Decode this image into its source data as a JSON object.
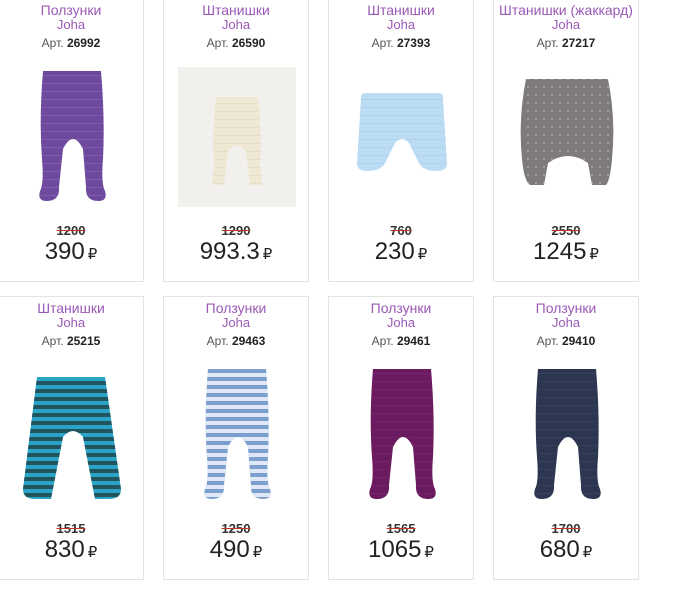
{
  "currency_symbol": "₽",
  "products": [
    {
      "title": "Ползунки",
      "brand": "Joha",
      "sku_label": "Арт.",
      "sku": "26992",
      "old_price": "1200",
      "price": "390",
      "icon": "footed-pants-purple",
      "colors": {
        "main": "#6e4a9e",
        "stripe": "#8865b5"
      }
    },
    {
      "title": "Штанишки",
      "brand": "Joha",
      "sku_label": "Арт.",
      "sku": "26590",
      "old_price": "1290",
      "price": "993.3",
      "icon": "pants-cream",
      "colors": {
        "main": "#efe8d4",
        "stripe": "#e0d6bc"
      }
    },
    {
      "title": "Штанишки",
      "brand": "Joha",
      "sku_label": "Арт.",
      "sku": "27393",
      "old_price": "760",
      "price": "230",
      "icon": "shorts-light-blue",
      "colors": {
        "main": "#bcdcf3",
        "stripe": "#a5cdee"
      }
    },
    {
      "title": "Штанишки (жаккард)",
      "brand": "Joha",
      "sku_label": "Арт.",
      "sku": "27217",
      "old_price": "2550",
      "price": "1245",
      "icon": "harem-pants-gray",
      "colors": {
        "main": "#7e7a7a",
        "stripe": "#b9b4b4"
      }
    },
    {
      "title": "Штанишки",
      "brand": "Joha",
      "sku_label": "Арт.",
      "sku": "25215",
      "old_price": "1515",
      "price": "830",
      "icon": "pants-teal-striped",
      "colors": {
        "main": "#2aa4c4",
        "stripe": "#22545f"
      }
    },
    {
      "title": "Ползунки",
      "brand": "Joha",
      "sku_label": "Арт.",
      "sku": "29463",
      "old_price": "1250",
      "price": "490",
      "icon": "footed-pants-blue-striped",
      "colors": {
        "main": "#7c9fd0",
        "stripe": "#dfe9f6"
      }
    },
    {
      "title": "Ползунки",
      "brand": "Joha",
      "sku_label": "Арт.",
      "sku": "29461",
      "old_price": "1565",
      "price": "1065",
      "icon": "footed-pants-plum",
      "colors": {
        "main": "#6a1a5e",
        "stripe": "#7f2a73"
      }
    },
    {
      "title": "Ползунки",
      "brand": "Joha",
      "sku_label": "Арт.",
      "sku": "29410",
      "old_price": "1700",
      "price": "680",
      "icon": "footed-pants-navy",
      "colors": {
        "main": "#2c3650",
        "stripe": "#3c4864"
      }
    }
  ]
}
